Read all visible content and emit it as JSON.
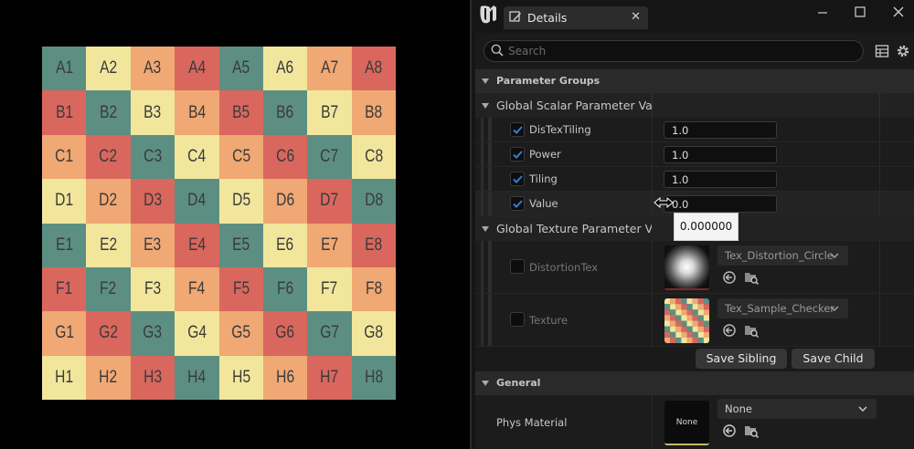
{
  "viewport": {
    "colors": {
      "teal": "#5c8f82",
      "yellow": "#f2e69c",
      "orange": "#f0a874",
      "red": "#d9675e"
    },
    "cells": [
      [
        "A1",
        "teal"
      ],
      [
        "A2",
        "yellow"
      ],
      [
        "A3",
        "orange"
      ],
      [
        "A4",
        "red"
      ],
      [
        "A5",
        "teal"
      ],
      [
        "A6",
        "yellow"
      ],
      [
        "A7",
        "orange"
      ],
      [
        "A8",
        "red"
      ],
      [
        "B1",
        "red"
      ],
      [
        "B2",
        "teal"
      ],
      [
        "B3",
        "yellow"
      ],
      [
        "B4",
        "orange"
      ],
      [
        "B5",
        "red"
      ],
      [
        "B6",
        "teal"
      ],
      [
        "B7",
        "yellow"
      ],
      [
        "B8",
        "orange"
      ],
      [
        "C1",
        "orange"
      ],
      [
        "C2",
        "red"
      ],
      [
        "C3",
        "teal"
      ],
      [
        "C4",
        "yellow"
      ],
      [
        "C5",
        "orange"
      ],
      [
        "C6",
        "red"
      ],
      [
        "C7",
        "teal"
      ],
      [
        "C8",
        "yellow"
      ],
      [
        "D1",
        "yellow"
      ],
      [
        "D2",
        "orange"
      ],
      [
        "D3",
        "red"
      ],
      [
        "D4",
        "teal"
      ],
      [
        "D5",
        "yellow"
      ],
      [
        "D6",
        "orange"
      ],
      [
        "D7",
        "red"
      ],
      [
        "D8",
        "teal"
      ],
      [
        "E1",
        "teal"
      ],
      [
        "E2",
        "yellow"
      ],
      [
        "E3",
        "orange"
      ],
      [
        "E4",
        "red"
      ],
      [
        "E5",
        "teal"
      ],
      [
        "E6",
        "yellow"
      ],
      [
        "E7",
        "orange"
      ],
      [
        "E8",
        "red"
      ],
      [
        "F1",
        "red"
      ],
      [
        "F2",
        "teal"
      ],
      [
        "F3",
        "yellow"
      ],
      [
        "F4",
        "orange"
      ],
      [
        "F5",
        "red"
      ],
      [
        "F6",
        "teal"
      ],
      [
        "F7",
        "yellow"
      ],
      [
        "F8",
        "orange"
      ],
      [
        "G1",
        "orange"
      ],
      [
        "G2",
        "red"
      ],
      [
        "G3",
        "teal"
      ],
      [
        "G4",
        "yellow"
      ],
      [
        "G5",
        "orange"
      ],
      [
        "G6",
        "red"
      ],
      [
        "G7",
        "teal"
      ],
      [
        "G8",
        "yellow"
      ],
      [
        "H1",
        "yellow"
      ],
      [
        "H2",
        "orange"
      ],
      [
        "H3",
        "red"
      ],
      [
        "H4",
        "teal"
      ],
      [
        "H5",
        "yellow"
      ],
      [
        "H6",
        "orange"
      ],
      [
        "H7",
        "red"
      ],
      [
        "H8",
        "teal"
      ]
    ]
  },
  "window": {
    "tab_label": "Details",
    "close_glyph": "✕",
    "minimize_glyph": "—",
    "maximize_glyph": "☐",
    "window_close_glyph": "✕"
  },
  "search": {
    "placeholder": "Search"
  },
  "sections": {
    "parameter_groups": "Parameter Groups",
    "scalar": "Global Scalar Parameter Values",
    "texture": "Global Texture Parameter Values",
    "general": "General"
  },
  "scalar_params": [
    {
      "name": "DisTexTiling",
      "value": "1.0",
      "checked": true
    },
    {
      "name": "Power",
      "value": "1.0",
      "checked": true
    },
    {
      "name": "Tiling",
      "value": "1.0",
      "checked": true
    },
    {
      "name": "Value",
      "value": "0.0",
      "checked": true
    }
  ],
  "texture_params": [
    {
      "name": "DistortionTex",
      "asset": "Tex_Distortion_Circle",
      "checked": false
    },
    {
      "name": "Texture",
      "asset": "Tex_Sample_Checker",
      "checked": false
    }
  ],
  "buttons": {
    "save_sibling": "Save Sibling",
    "save_child": "Save Child"
  },
  "general": {
    "phys_material_label": "Phys Material",
    "thumb_text": "None",
    "dropdown_value": "None"
  },
  "tooltip": {
    "value": "0.000000"
  },
  "accent": "#2f7fd6"
}
